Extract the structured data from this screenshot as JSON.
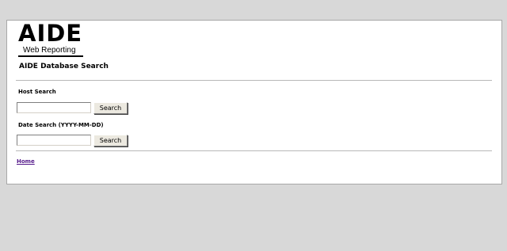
{
  "logo": {
    "word": "AIDE",
    "subtitle": "Web Reporting"
  },
  "page": {
    "title": "AIDE Database Search"
  },
  "host_search": {
    "label": "Host Search",
    "value": "",
    "button_label": "Search"
  },
  "date_search": {
    "label": "Date Search (YYYY-MM-DD)",
    "value": "",
    "button_label": "Search"
  },
  "footer": {
    "home_link": "Home"
  },
  "colors": {
    "page_background": "#d8d8d8",
    "panel_background": "#ffffff",
    "visited_link": "#551a8b"
  }
}
